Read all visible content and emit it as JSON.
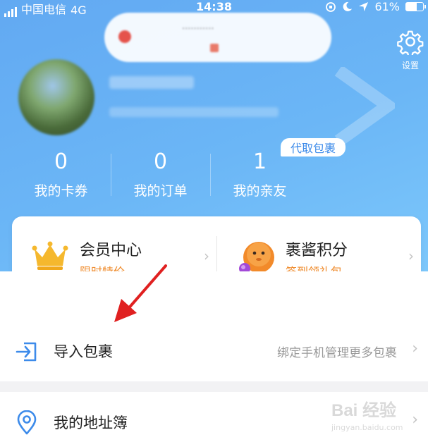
{
  "status_bar": {
    "carrier": "中国电信",
    "network": "4G",
    "time": "14:38",
    "battery": "61%",
    "battery_level": 0.61
  },
  "settings": {
    "label": "设置"
  },
  "pickup_badge": "代取包裹",
  "stats": [
    {
      "value": "0",
      "label": "我的卡券"
    },
    {
      "value": "0",
      "label": "我的订单"
    },
    {
      "value": "1",
      "label": "我的亲友"
    }
  ],
  "member_card": {
    "left": {
      "title": "会员中心",
      "subtitle": "限时特价"
    },
    "right": {
      "title": "裹酱积分",
      "subtitle": "签到领礼包"
    }
  },
  "list": [
    {
      "title": "导入包裹",
      "hint": "绑定手机管理更多包裹",
      "icon": "import-icon"
    },
    {
      "title": "我的地址簿",
      "hint": "",
      "icon": "location-pin-icon"
    }
  ],
  "watermark": {
    "main": "Bai 经验",
    "sub": "jingyan.baidu.com"
  },
  "colors": {
    "header_blue": "#6bb6f6",
    "accent_orange": "#ef8b2c",
    "icon_blue": "#3d8bea",
    "annotation_red": "#e02020"
  }
}
